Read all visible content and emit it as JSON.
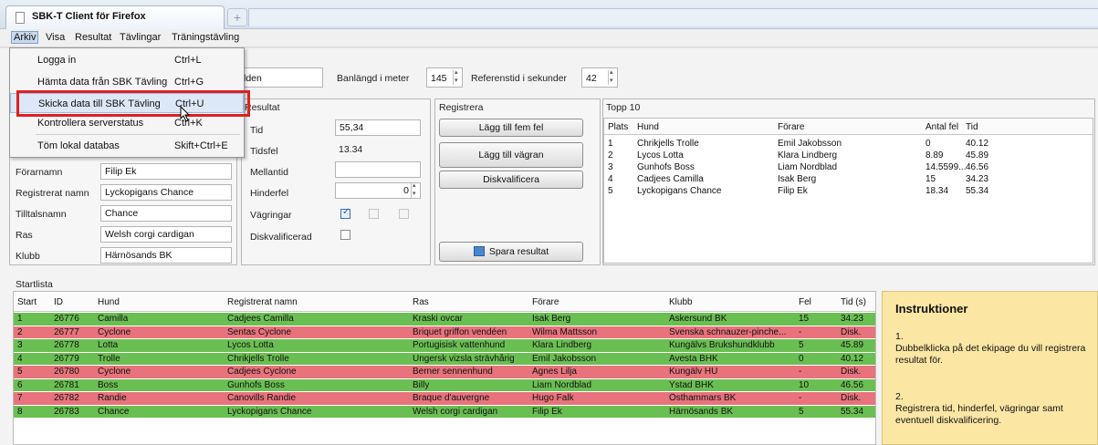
{
  "browser": {
    "tab_title": "SBK-T Client för Firefox",
    "new_tab": "+"
  },
  "menu": {
    "arkiv": "Arkiv",
    "visa": "Visa",
    "resultat": "Resultat",
    "tavlingar": "Tävlingar",
    "traningstavling": "Träningstävling"
  },
  "dropdown": [
    {
      "label": "Logga in",
      "shortcut": "Ctrl+L"
    },
    {
      "label": "Hämta data från SBK Tävling",
      "shortcut": "Ctrl+G"
    },
    {
      "label": "Skicka data till SBK Tävling",
      "shortcut": "Ctrl+U"
    },
    {
      "label": "Kontrollera serverstatus",
      "shortcut": "Ctrl+K"
    },
    {
      "label": "Töm lokal databas",
      "shortcut": "Skift+Ctrl+E"
    }
  ],
  "top_fields": {
    "partial_value": "lden",
    "banlangd_label": "Banlängd i meter",
    "banlangd_value": "145",
    "referenstid_label": "Referenstid i sekunder",
    "referenstid_value": "42"
  },
  "ekipage": {
    "forarnamn_label": "Förarnamn",
    "forarnamn": "Filip Ek",
    "regnamn_label": "Registrerat namn",
    "regnamn": "Lyckopigans Chance",
    "tilltal_label": "Tilltalsnamn",
    "tilltal": "Chance",
    "ras_label": "Ras",
    "ras": "Welsh corgi cardigan",
    "klubb_label": "Klubb",
    "klubb": "Härnösands BK"
  },
  "resultat": {
    "title": "Resultat",
    "tid_label": "Tid",
    "tid": "55,34",
    "tidsfel_label": "Tidsfel",
    "tidsfel": "13.34",
    "mellantid_label": "Mellantid",
    "mellantid": "",
    "hinderfel_label": "Hinderfel",
    "hinderfel": "0",
    "vagringar_label": "Vägringar",
    "diskvalificerad_label": "Diskvalificerad"
  },
  "registrera": {
    "title": "Registrera",
    "btn_fem_fel": "Lägg till fem fel",
    "btn_vagran": "Lägg till vägran",
    "btn_diskvalificera": "Diskvalificera",
    "btn_spara": "Spara resultat"
  },
  "topp10": {
    "title": "Topp 10",
    "headers": [
      "Plats",
      "Hund",
      "Förare",
      "Antal fel",
      "Tid"
    ],
    "rows": [
      [
        "1",
        "Chrikjells Trolle",
        "Emil Jakobsson",
        "0",
        "40.12"
      ],
      [
        "2",
        "Lycos Lotta",
        "Klara Lindberg",
        "8.89",
        "45.89"
      ],
      [
        "3",
        "Gunhofs Boss",
        "Liam Nordblad",
        "14.5599...",
        "46.56"
      ],
      [
        "4",
        "Cadjees Camilla",
        "Isak Berg",
        "15",
        "34.23"
      ],
      [
        "5",
        "Lyckopigans Chance",
        "Filip Ek",
        "18.34",
        "55.34"
      ]
    ]
  },
  "startlista": {
    "title": "Startlista",
    "headers": [
      "Start",
      "ID",
      "Hund",
      "Registrerat namn",
      "Ras",
      "Förare",
      "Klubb",
      "Fel",
      "Tid (s)"
    ],
    "rows": [
      {
        "status": "green",
        "cells": [
          "1",
          "26776",
          "Camilla",
          "Cadjees Camilla",
          "Kraski ovcar",
          "Isak Berg",
          "Askersund BK",
          "15",
          "34.23"
        ]
      },
      {
        "status": "red",
        "cells": [
          "2",
          "26777",
          "Cyclone",
          "Sentas Cyclone",
          "Briquet griffon vendéen",
          "Wilma Mattsson",
          "Svenska schnauzer-pinche...",
          "-",
          "Disk."
        ]
      },
      {
        "status": "green",
        "cells": [
          "3",
          "26778",
          "Lotta",
          "Lycos Lotta",
          "Portugisisk vattenhund",
          "Klara Lindberg",
          "Kungälvs Brukshundklubb",
          "5",
          "45.89"
        ]
      },
      {
        "status": "green",
        "cells": [
          "4",
          "26779",
          "Trolle",
          "Chrikjells Trolle",
          "Ungersk vizsla strävhårig",
          "Emil Jakobsson",
          "Avesta BHK",
          "0",
          "40.12"
        ]
      },
      {
        "status": "red",
        "cells": [
          "5",
          "26780",
          "Cyclone",
          "Cadjees Cyclone",
          "Berner sennenhund",
          "Agnes Lilja",
          "Kungälv HU",
          "-",
          "Disk."
        ]
      },
      {
        "status": "green",
        "cells": [
          "6",
          "26781",
          "Boss",
          "Gunhofs Boss",
          "Billy",
          "Liam Nordblad",
          "Ystad BHK",
          "10",
          "46.56"
        ]
      },
      {
        "status": "red",
        "cells": [
          "7",
          "26782",
          "Randie",
          "Canovills Randie",
          "Braque d'auvergne",
          "Hugo Falk",
          "Östhammars BK",
          "-",
          "Disk."
        ]
      },
      {
        "status": "green",
        "cells": [
          "8",
          "26783",
          "Chance",
          "Lyckopigans Chance",
          "Welsh corgi cardigan",
          "Filip Ek",
          "Härnösands BK",
          "5",
          "55.34"
        ]
      }
    ]
  },
  "instruktioner": {
    "title": "Instruktioner",
    "step1_num": "1.",
    "step1_text": "Dubbelklicka på det ekipage du vill registrera resultat för.",
    "step2_num": "2.",
    "step2_text": "Registrera tid, hinderfel, vägringar samt eventuell diskvalificering."
  }
}
